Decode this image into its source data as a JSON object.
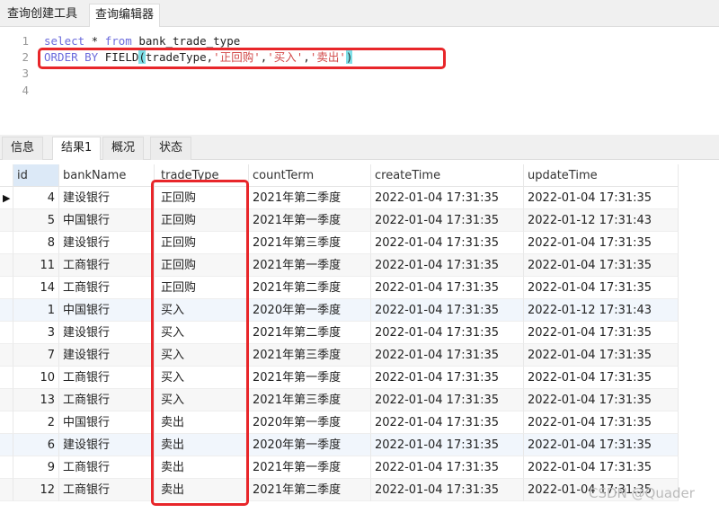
{
  "top_tabs": [
    "查询创建工具",
    "查询编辑器"
  ],
  "editor": {
    "line_numbers": [
      "1",
      "2",
      "3",
      "4"
    ],
    "line1": {
      "kw1": "select",
      "mid": " * ",
      "kw2": "from",
      "rest": " bank_trade_type"
    },
    "line2": {
      "kw": "ORDER BY",
      "fn": " FIELD",
      "open": "(",
      "arg": "tradeType,",
      "s1": "'正回购'",
      "c1": ",",
      "s2": "'买入'",
      "c2": ",",
      "s3": "'卖出'",
      "close": ")"
    }
  },
  "result_tabs": [
    "信息",
    "结果1",
    "概况",
    "状态"
  ],
  "columns": [
    "id",
    "bankName",
    "tradeType",
    "countTerm",
    "createTime",
    "updateTime"
  ],
  "rows": [
    [
      "4",
      "建设银行",
      "正回购",
      "2021年第二季度",
      "2022-01-04 17:31:35",
      "2022-01-04 17:31:35"
    ],
    [
      "5",
      "中国银行",
      "正回购",
      "2021年第一季度",
      "2022-01-04 17:31:35",
      "2022-01-12 17:31:43"
    ],
    [
      "8",
      "建设银行",
      "正回购",
      "2021年第三季度",
      "2022-01-04 17:31:35",
      "2022-01-04 17:31:35"
    ],
    [
      "11",
      "工商银行",
      "正回购",
      "2021年第一季度",
      "2022-01-04 17:31:35",
      "2022-01-04 17:31:35"
    ],
    [
      "14",
      "工商银行",
      "正回购",
      "2021年第二季度",
      "2022-01-04 17:31:35",
      "2022-01-04 17:31:35"
    ],
    [
      "1",
      "中国银行",
      "买入",
      "2020年第一季度",
      "2022-01-04 17:31:35",
      "2022-01-12 17:31:43"
    ],
    [
      "3",
      "建设银行",
      "买入",
      "2021年第二季度",
      "2022-01-04 17:31:35",
      "2022-01-04 17:31:35"
    ],
    [
      "7",
      "建设银行",
      "买入",
      "2021年第三季度",
      "2022-01-04 17:31:35",
      "2022-01-04 17:31:35"
    ],
    [
      "10",
      "工商银行",
      "买入",
      "2021年第一季度",
      "2022-01-04 17:31:35",
      "2022-01-04 17:31:35"
    ],
    [
      "13",
      "工商银行",
      "买入",
      "2021年第三季度",
      "2022-01-04 17:31:35",
      "2022-01-04 17:31:35"
    ],
    [
      "2",
      "中国银行",
      "卖出",
      "2020年第一季度",
      "2022-01-04 17:31:35",
      "2022-01-04 17:31:35"
    ],
    [
      "6",
      "建设银行",
      "卖出",
      "2020年第一季度",
      "2022-01-04 17:31:35",
      "2022-01-04 17:31:35"
    ],
    [
      "9",
      "工商银行",
      "卖出",
      "2021年第一季度",
      "2022-01-04 17:31:35",
      "2022-01-04 17:31:35"
    ],
    [
      "12",
      "工商银行",
      "卖出",
      "2021年第二季度",
      "2022-01-04 17:31:35",
      "2022-01-04 17:31:35"
    ]
  ],
  "current_row_icon": "▶",
  "watermark": "CSDN @Quader",
  "colors": {
    "highlight": "#e8262a",
    "keyword": "#6b6bdc",
    "string": "#d24a4a"
  }
}
